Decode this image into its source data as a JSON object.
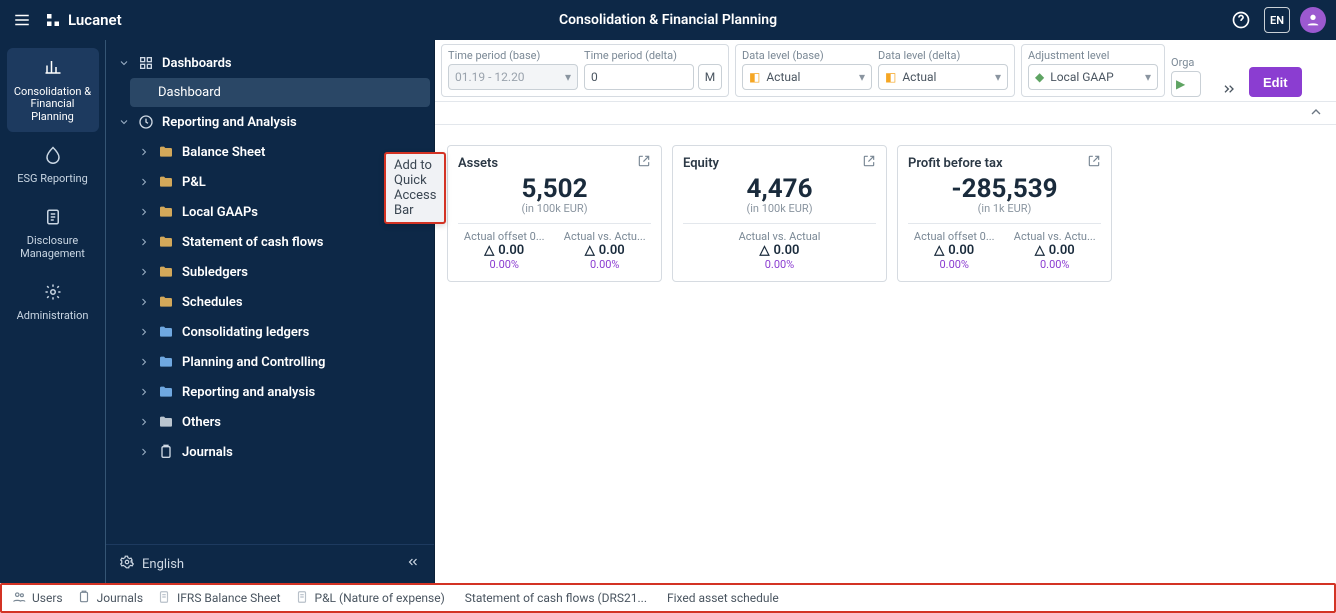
{
  "app": {
    "brand": "Lucanet",
    "title": "Consolidation & Financial Planning",
    "lang_badge": "EN"
  },
  "rail": {
    "items": [
      {
        "label": "Consolidation & Financial Planning",
        "active": true,
        "icon": "chart"
      },
      {
        "label": "ESG Reporting",
        "active": false,
        "icon": "leaf"
      },
      {
        "label": "Disclosure Management",
        "active": false,
        "icon": "doc"
      },
      {
        "label": "Administration",
        "active": false,
        "icon": "gear"
      }
    ]
  },
  "contextmenu": {
    "label": "Add to Quick Access Bar"
  },
  "tree": {
    "dashboards": {
      "label": "Dashboards",
      "child": "Dashboard"
    },
    "reporting": {
      "label": "Reporting and Analysis"
    },
    "reporting_children": [
      {
        "label": "Balance Sheet",
        "color": "sandy"
      },
      {
        "label": "P&L",
        "color": "sandy"
      },
      {
        "label": "Local GAAPs",
        "color": "sandy"
      },
      {
        "label": "Statement of cash flows",
        "color": "sandy"
      },
      {
        "label": "Subledgers",
        "color": "sandy"
      },
      {
        "label": "Schedules",
        "color": "sandy"
      },
      {
        "label": "Consolidating ledgers",
        "color": "blue"
      },
      {
        "label": "Planning and Controlling",
        "color": "blue"
      },
      {
        "label": "Reporting and analysis",
        "color": "blue"
      },
      {
        "label": "Others",
        "color": "gray"
      }
    ],
    "journals": {
      "label": "Journals"
    }
  },
  "lang_footer": {
    "label": "English"
  },
  "filters": {
    "time_base": {
      "label": "Time period (base)",
      "value": "01.19 - 12.20"
    },
    "time_delta": {
      "label": "Time period (delta)",
      "value": "0",
      "unit": "M"
    },
    "data_base": {
      "label": "Data level (base)",
      "value": "Actual"
    },
    "data_delta": {
      "label": "Data level (delta)",
      "value": "Actual"
    },
    "adj": {
      "label": "Adjustment level",
      "value": "Local GAAP"
    },
    "org": {
      "label": "Orga"
    },
    "edit": "Edit"
  },
  "cards": [
    {
      "title": "Assets",
      "value": "5,502",
      "unit": "(in 100k EUR)",
      "metrics": [
        {
          "label": "Actual offset 0...",
          "val": "0.00",
          "pct": "0.00%"
        },
        {
          "label": "Actual vs. Actu...",
          "val": "0.00",
          "pct": "0.00%"
        }
      ]
    },
    {
      "title": "Equity",
      "value": "4,476",
      "unit": "(in 100k EUR)",
      "metrics": [
        {
          "label": "Actual vs. Actual",
          "val": "0.00",
          "pct": "0.00%"
        }
      ]
    },
    {
      "title": "Profit before tax",
      "value": "-285,539",
      "unit": "(in 1k EUR)",
      "metrics": [
        {
          "label": "Actual offset 0...",
          "val": "0.00",
          "pct": "0.00%"
        },
        {
          "label": "Actual vs. Actu...",
          "val": "0.00",
          "pct": "0.00%"
        }
      ]
    }
  ],
  "bottombar": [
    {
      "icon": "users",
      "label": "Users"
    },
    {
      "icon": "clipboard",
      "label": "Journals"
    },
    {
      "icon": "report",
      "label": "IFRS Balance Sheet"
    },
    {
      "icon": "report",
      "label": "P&L (Nature of expense)"
    },
    {
      "icon": "dot",
      "color": "#f5a623",
      "label": "Statement of cash flows (DRS21..."
    },
    {
      "icon": "dot",
      "color": "#8aa8e8",
      "label": "Fixed asset schedule"
    }
  ]
}
